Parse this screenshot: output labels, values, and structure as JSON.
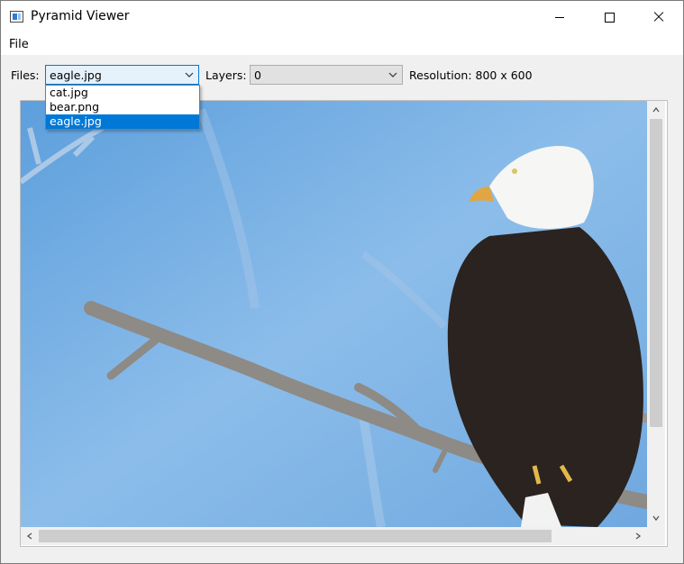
{
  "window": {
    "title": "Pyramid Viewer"
  },
  "menu": {
    "file": "File"
  },
  "toolbar": {
    "files_label": "Files:",
    "files_value": "eagle.jpg",
    "layers_label": "Layers:",
    "layers_value": "0",
    "resolution_text": "Resolution: 800 x 600"
  },
  "files_dropdown": {
    "options": [
      "cat.jpg",
      "bear.png",
      "eagle.jpg"
    ],
    "selected": "eagle.jpg"
  },
  "colors": {
    "accent": "#0078d7",
    "sky": "#7fb3e3",
    "scroll_thumb": "#cdcdcd"
  },
  "icons": {
    "app": "window-icon",
    "minimize": "minimize-icon",
    "maximize": "maximize-icon",
    "close": "close-icon",
    "dropdown": "chevron-down-icon"
  }
}
